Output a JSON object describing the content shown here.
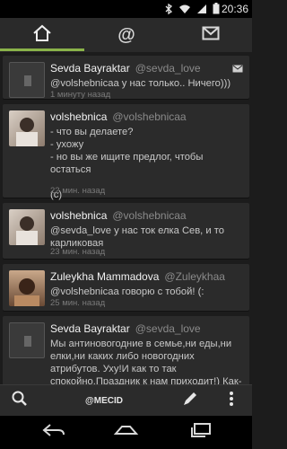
{
  "status": {
    "time": "20:36"
  },
  "tabs": [
    {
      "name": "home",
      "icon": "home-icon"
    },
    {
      "name": "mentions",
      "icon": "at-icon"
    },
    {
      "name": "messages",
      "icon": "mail-icon"
    }
  ],
  "tweets": [
    {
      "name": "Sevda Bayraktar",
      "handle": "@sevda_love",
      "text": "@volshebnicaa у нас только.. Ничего)))",
      "time": "1 минуту назад"
    },
    {
      "name": "volshebnica",
      "handle": "@volshebnicaa",
      "text": "- что вы делаете?\n- ухожу\n- но вы же ищите предлог, чтобы остаться\n\n(с)",
      "time": "22 мин. назад"
    },
    {
      "name": "volshebnica",
      "handle": "@volshebnicaa",
      "text": "@sevda_love у нас ток елка Сев, и то карликовая",
      "time": "23 мин. назад"
    },
    {
      "name": "Zuleykha Mammadova",
      "handle": "@Zuleykhaa",
      "text": "@volshebnicaa говорю с тобой! (:",
      "time": "25 мин. назад"
    },
    {
      "name": "Sevda Bayraktar",
      "handle": "@sevda_love",
      "text": "Мы антиновогодние в семье,ни еды,ни елки,ни каких либо новогодних атрибутов. Ухy!И как то так спокойно.Праздник к нам приходит!) Как-то так",
      "time": ""
    }
  ],
  "bottombar": {
    "account": "@MECID"
  }
}
